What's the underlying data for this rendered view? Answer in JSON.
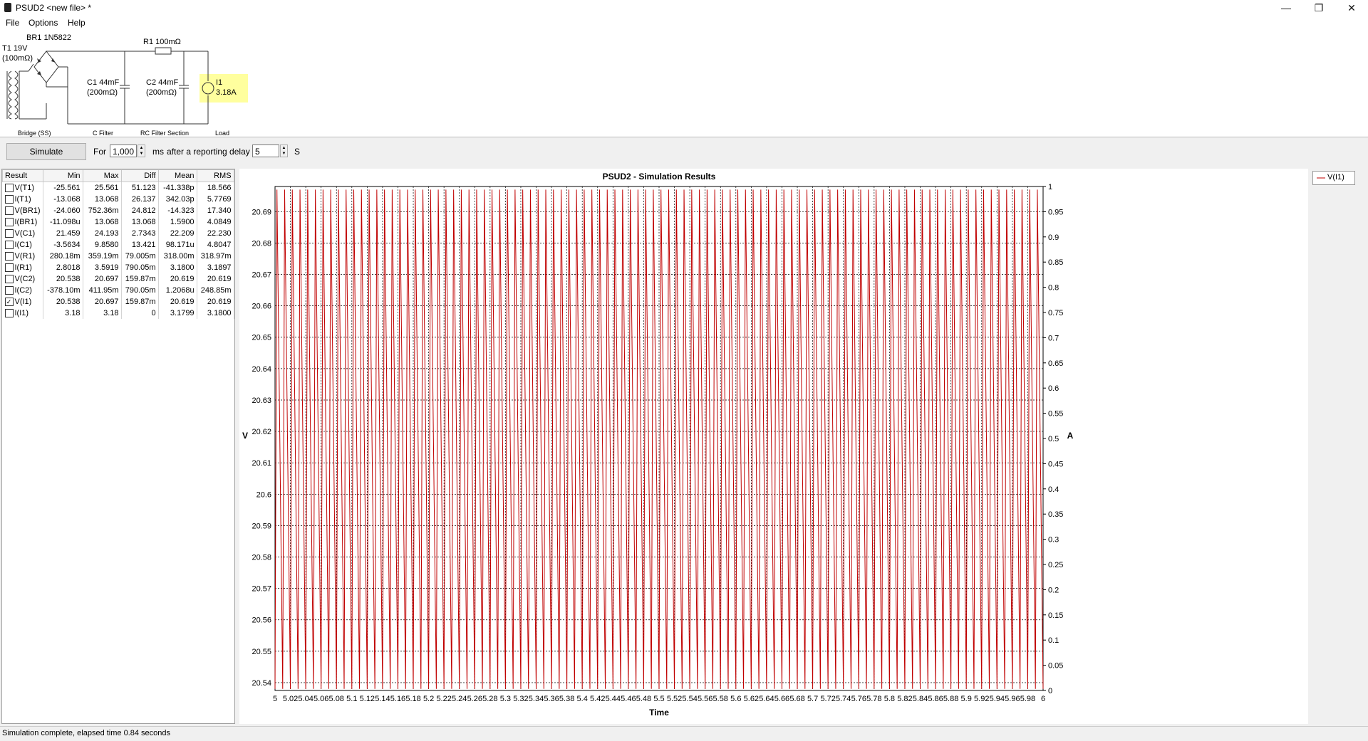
{
  "window": {
    "title": "PSUD2  <new file> *",
    "controls": [
      "—",
      "❐",
      "✕"
    ]
  },
  "menu": [
    "File",
    "Options",
    "Help"
  ],
  "schematic": {
    "bridge_label": "BR1 1N5822",
    "transformer_line1": "T1 19V",
    "transformer_line2": "(100mΩ)",
    "r1_label": "R1 100mΩ",
    "c1_line1": "C1 44mF",
    "c1_line2": "(200mΩ)",
    "c2_line1": "C2 44mF",
    "c2_line2": "(200mΩ)",
    "i1_line1": "I1",
    "i1_line2": "3.18A",
    "sections": [
      "Bridge (SS)",
      "C Filter",
      "RC Filter Section",
      "Load"
    ]
  },
  "toolbar": {
    "simulate_label": "Simulate",
    "for_label": "For",
    "duration_value": "1,000",
    "ms_label": "ms",
    "delay_label": "after a reporting delay of",
    "delay_value": "5",
    "s_label": "S"
  },
  "results": {
    "headers": [
      "Result",
      "Min",
      "Max",
      "Diff",
      "Mean",
      "RMS"
    ],
    "rows": [
      {
        "name": "V(T1)",
        "checked": false,
        "min": "-25.561",
        "max": "25.561",
        "diff": "51.123",
        "mean": "-41.338p",
        "rms": "18.566"
      },
      {
        "name": "I(T1)",
        "checked": false,
        "min": "-13.068",
        "max": "13.068",
        "diff": "26.137",
        "mean": "342.03p",
        "rms": "5.7769"
      },
      {
        "name": "V(BR1)",
        "checked": false,
        "min": "-24.060",
        "max": "752.36m",
        "diff": "24.812",
        "mean": "-14.323",
        "rms": "17.340"
      },
      {
        "name": "I(BR1)",
        "checked": false,
        "min": "-11.098u",
        "max": "13.068",
        "diff": "13.068",
        "mean": "1.5900",
        "rms": "4.0849"
      },
      {
        "name": "V(C1)",
        "checked": false,
        "min": "21.459",
        "max": "24.193",
        "diff": "2.7343",
        "mean": "22.209",
        "rms": "22.230"
      },
      {
        "name": "I(C1)",
        "checked": false,
        "min": "-3.5634",
        "max": "9.8580",
        "diff": "13.421",
        "mean": "98.171u",
        "rms": "4.8047"
      },
      {
        "name": "V(R1)",
        "checked": false,
        "min": "280.18m",
        "max": "359.19m",
        "diff": "79.005m",
        "mean": "318.00m",
        "rms": "318.97m"
      },
      {
        "name": "I(R1)",
        "checked": false,
        "min": "2.8018",
        "max": "3.5919",
        "diff": "790.05m",
        "mean": "3.1800",
        "rms": "3.1897"
      },
      {
        "name": "V(C2)",
        "checked": false,
        "min": "20.538",
        "max": "20.697",
        "diff": "159.87m",
        "mean": "20.619",
        "rms": "20.619"
      },
      {
        "name": "I(C2)",
        "checked": false,
        "min": "-378.10m",
        "max": "411.95m",
        "diff": "790.05m",
        "mean": "1.2068u",
        "rms": "248.85m"
      },
      {
        "name": "V(I1)",
        "checked": true,
        "min": "20.538",
        "max": "20.697",
        "diff": "159.87m",
        "mean": "20.619",
        "rms": "20.619"
      },
      {
        "name": "I(I1)",
        "checked": false,
        "min": "3.18",
        "max": "3.18",
        "diff": "0",
        "mean": "3.1799",
        "rms": "3.1800"
      }
    ]
  },
  "chart_data": {
    "type": "line",
    "title": "PSUD2 - Simulation Results",
    "xlabel": "Time",
    "ylabel": "V",
    "y2label": "A",
    "xlim": [
      5,
      6
    ],
    "ylim": [
      20.5375,
      20.698
    ],
    "y2lim": [
      0,
      1
    ],
    "x_ticks": [
      "5",
      "5.02",
      "5.04",
      "5.06",
      "5.08",
      "5.1",
      "5.12",
      "5.14",
      "5.16",
      "5.18",
      "5.2",
      "5.22",
      "5.24",
      "5.26",
      "5.28",
      "5.3",
      "5.32",
      "5.34",
      "5.36",
      "5.38",
      "5.4",
      "5.42",
      "5.44",
      "5.46",
      "5.48",
      "5.5",
      "5.52",
      "5.54",
      "5.56",
      "5.58",
      "5.6",
      "5.62",
      "5.64",
      "5.66",
      "5.68",
      "5.7",
      "5.72",
      "5.74",
      "5.76",
      "5.78",
      "5.8",
      "5.82",
      "5.84",
      "5.86",
      "5.88",
      "5.9",
      "5.92",
      "5.94",
      "5.96",
      "5.98",
      "6"
    ],
    "y_ticks": [
      "20.54",
      "20.55",
      "20.56",
      "20.57",
      "20.58",
      "20.59",
      "20.6",
      "20.61",
      "20.62",
      "20.63",
      "20.64",
      "20.65",
      "20.66",
      "20.67",
      "20.68",
      "20.69"
    ],
    "y2_ticks": [
      "0",
      "0.05",
      "0.1",
      "0.15",
      "0.2",
      "0.25",
      "0.3",
      "0.35",
      "0.4",
      "0.45",
      "0.5",
      "0.55",
      "0.6",
      "0.65",
      "0.7",
      "0.75",
      "0.8",
      "0.85",
      "0.9",
      "0.95",
      "1"
    ],
    "grid": true,
    "legend_position": "top-right",
    "series": [
      {
        "name": "V(I1)",
        "color": "#c00000",
        "frequency_hz": 100,
        "min": 20.538,
        "max": 20.697
      }
    ]
  },
  "status": "Simulation complete, elapsed time 0.84 seconds"
}
